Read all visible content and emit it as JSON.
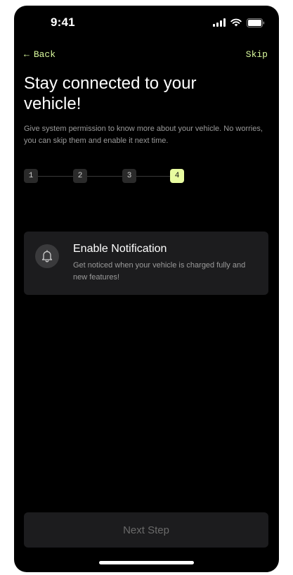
{
  "status_bar": {
    "time": "9:41",
    "icons": [
      "signal-icon",
      "wifi-icon",
      "battery-icon"
    ]
  },
  "nav": {
    "back_arrow": "←",
    "back_label": "Back",
    "skip_label": "Skip"
  },
  "header": {
    "title": "Stay connected to your vehicle!",
    "subtitle": "Give system permission to know more about your vehicle. No worries, you can skip them and enable it next time."
  },
  "stepper": {
    "steps": [
      "1",
      "2",
      "3",
      "4"
    ],
    "active_step": 4
  },
  "permission_card": {
    "icon": "bell-icon",
    "title": "Enable Notification",
    "description": "Get noticed when your vehicle is charged fully and new features!"
  },
  "footer": {
    "next_label": "Next Step"
  },
  "colors": {
    "accent": "#e8fca0",
    "link": "#d9f99d",
    "background": "#000000",
    "card": "#1c1c1e",
    "muted_text": "#9a9a9a"
  }
}
